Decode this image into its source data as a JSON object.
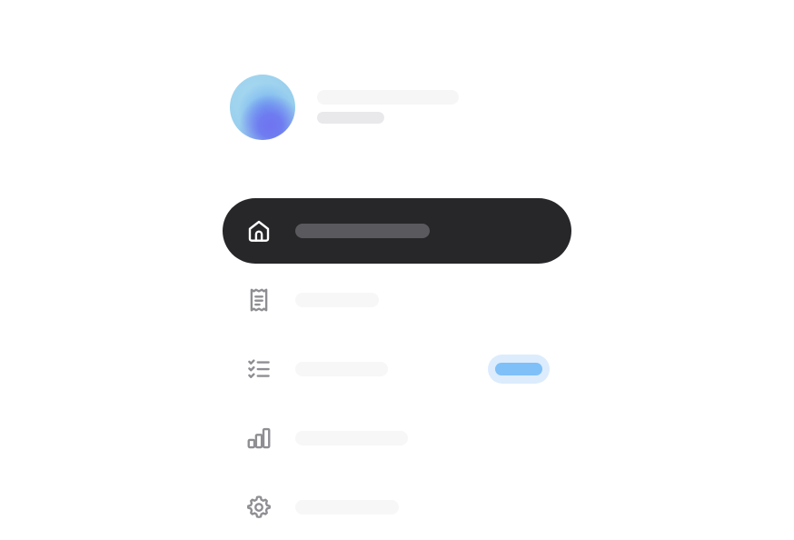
{
  "profile": {
    "name": "",
    "subtitle": ""
  },
  "nav": {
    "items": [
      {
        "id": "home",
        "icon": "home-icon",
        "label": "",
        "active": true
      },
      {
        "id": "receipts",
        "icon": "receipt-icon",
        "label": "",
        "active": false
      },
      {
        "id": "tasks",
        "icon": "checklist-icon",
        "label": "",
        "active": false,
        "badge": ""
      },
      {
        "id": "analytics",
        "icon": "bar-chart-icon",
        "label": "",
        "active": false
      },
      {
        "id": "settings",
        "icon": "gear-icon",
        "label": "",
        "active": false
      }
    ]
  },
  "colors": {
    "active_bg": "#27272a",
    "active_icon": "#ffffff",
    "inactive_icon": "#8e8e93",
    "badge_bg": "#dcecfd",
    "badge_fill": "#7fc0f8"
  }
}
